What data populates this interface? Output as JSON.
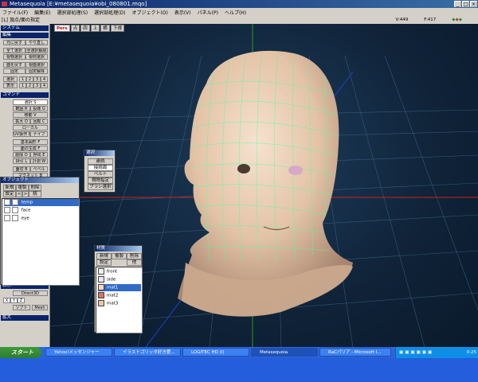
{
  "title": "Metasequoia [E:¥metasequoia¥obi_080801.mqo]",
  "window_controls": {
    "minimize": "_",
    "maximize": "□",
    "close": "×"
  },
  "menu": [
    "ファイル(F)",
    "編集(E)",
    "選択部処理(S)",
    "選択部処理(D)",
    "オブジェクト(O)",
    "表示(V)",
    "パネル(P)",
    "ヘルプ(H)"
  ],
  "status": "[L] 頂点/面の指定",
  "view_info": {
    "v": "V:449",
    "f": "F:417"
  },
  "view_tabs": [
    "Pers",
    "点",
    "四",
    "上",
    "横",
    "下視"
  ],
  "left_panel": {
    "system_header": "システム",
    "edit_header": "編集",
    "edit_buttons": [
      "元に戻す",
      "やり直し",
      "全て選択",
      "全選択解除",
      "視物選択",
      "視材選択",
      "面を戻す",
      "視面選択",
      "固定",
      "固定解除"
    ],
    "num_labels": [
      "選択",
      "表示"
    ],
    "num_buttons": [
      "1",
      "2",
      "3",
      "4"
    ],
    "command_header": "コマンド",
    "command_buttons": [
      "選択 S",
      "範囲 R",
      "投縄 G",
      "移動 V",
      "拡大 O",
      "回転 C",
      "ローカル",
      "UV操作 U",
      "ナイフ",
      "基本図形 F",
      "面の生成 F",
      "削除 D",
      "押出 E",
      "掃引 L",
      "計測 W",
      "面切 B",
      "ベベル",
      "マグネット B"
    ],
    "lower_buttons": [
      "Direct3D",
      "ソフト",
      "Mesh"
    ],
    "lower_toggles": [
      "X",
      "Y",
      "Z"
    ],
    "extra_header": "拡大",
    "option_header": "表示"
  },
  "select_palette": {
    "header": "選択",
    "buttons": [
      "連続",
      "接続面",
      "ベルト",
      "視物指定",
      "ブラシ選択"
    ]
  },
  "object_panel": {
    "header": "オブジェクト",
    "buttons": [
      "新規",
      "複製",
      "削除",
      "設定",
      "<",
      ">",
      "統"
    ],
    "items": [
      {
        "name": "temp",
        "selected": true
      },
      {
        "name": "face",
        "selected": false
      },
      {
        "name": "eye",
        "selected": false
      }
    ]
  },
  "material_panel": {
    "header": "材質",
    "buttons": [
      "新規",
      "複製",
      "削除",
      "設定",
      "他"
    ],
    "items": [
      {
        "name": "front",
        "color": "#f0f0f0",
        "selected": false
      },
      {
        "name": "side",
        "color": "#e8e8e8",
        "selected": false
      },
      {
        "name": "mat1",
        "color": "#f5d6c0",
        "selected": true
      },
      {
        "name": "mat2",
        "color": "#e07060",
        "selected": false
      },
      {
        "name": "mat3",
        "color": "#e8c8a8",
        "selected": false
      }
    ]
  },
  "taskbar": {
    "start_label": "スタート",
    "tasks": [
      "Yahoo!メッセンジャー",
      "イラストゴリッタ好き愛...",
      "LOGITEC HD (I)",
      "Metasequoia",
      "RaCパリア - Microsoft I..."
    ],
    "active_task_index": 3,
    "clock": "0:25"
  },
  "colors": {
    "mesh": "#4dffa0",
    "skin": "#e8cbb0",
    "viewport": "#15304a",
    "accent": "#0a246a"
  }
}
